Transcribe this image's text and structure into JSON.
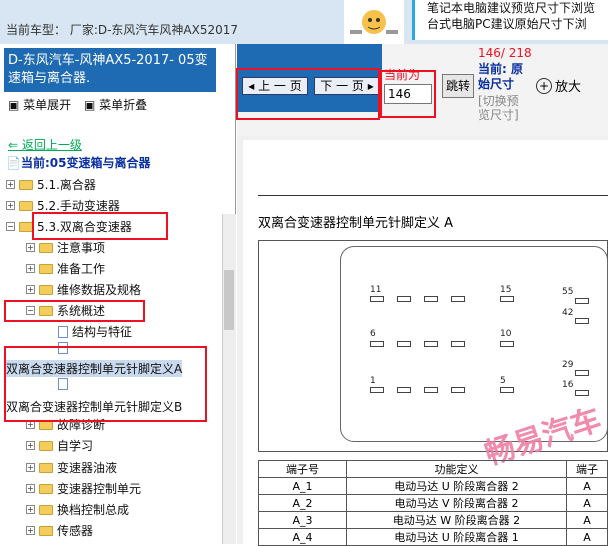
{
  "header": {
    "vehicle_line": "当前车型： 厂家:D-东风汽车风神AX52017",
    "banner_lines": [
      "笔记本电脑建议预览尺寸下浏览",
      "台式电脑PC建议原始尺寸下浏"
    ]
  },
  "left": {
    "title": "D-东风汽车-风神AX5-2017- 05变速箱与离合器.",
    "expand_label": "菜单展开",
    "collapse_label": "菜单折叠",
    "back_label": "返回上一级",
    "current_label": "当前:05变速箱与离合器",
    "tree": [
      {
        "label": "5.1.离合器"
      },
      {
        "label": "5.2.手动变速器"
      },
      {
        "label": "5.3.双离合变速器"
      },
      {
        "label": "注意事项"
      },
      {
        "label": "准备工作"
      },
      {
        "label": "维修数据及规格"
      },
      {
        "label": "系统概述"
      },
      {
        "label": "结构与特征"
      },
      {
        "label": "双离合变速器控制单元针脚定义A"
      },
      {
        "label": "双离合变速器控制单元针脚定义B"
      },
      {
        "label": "故障诊断"
      },
      {
        "label": "自学习"
      },
      {
        "label": "变速器油液"
      },
      {
        "label": "变速器控制单元"
      },
      {
        "label": "换档控制总成"
      },
      {
        "label": "传感器"
      }
    ]
  },
  "toolbar": {
    "prev_label": "上 一 页",
    "next_label": "下 一 页",
    "current_page_label": "当前为",
    "page_value": "146",
    "jump_label": "跳转",
    "page_count": "146/ 218",
    "current_size_label": "当前: 原始尺寸",
    "switch_label": "[切换预览尺寸]",
    "zoom_label": "放大"
  },
  "document": {
    "title": "双离合变速器控制单元针脚定义 A",
    "pin_labels": [
      "11",
      "15",
      "6",
      "10",
      "1",
      "5",
      "55",
      "42",
      "29",
      "16"
    ],
    "watermark": "畅易汽车",
    "table_headers": [
      "端子号",
      "功能定义",
      "端子"
    ],
    "table_rows": [
      [
        "A_1",
        "电动马达 U 阶段离合器 2",
        "A"
      ],
      [
        "A_2",
        "电动马达 V 阶段离合器 2",
        "A"
      ],
      [
        "A_3",
        "电动马达 W 阶段离合器 2",
        "A"
      ],
      [
        "A_4",
        "电动马达 U 阶段离合器 1",
        "A"
      ]
    ]
  },
  "colors": {
    "accent": "#1f6bb3",
    "highlight": "#e12222",
    "watermark": "#f07fa2"
  }
}
